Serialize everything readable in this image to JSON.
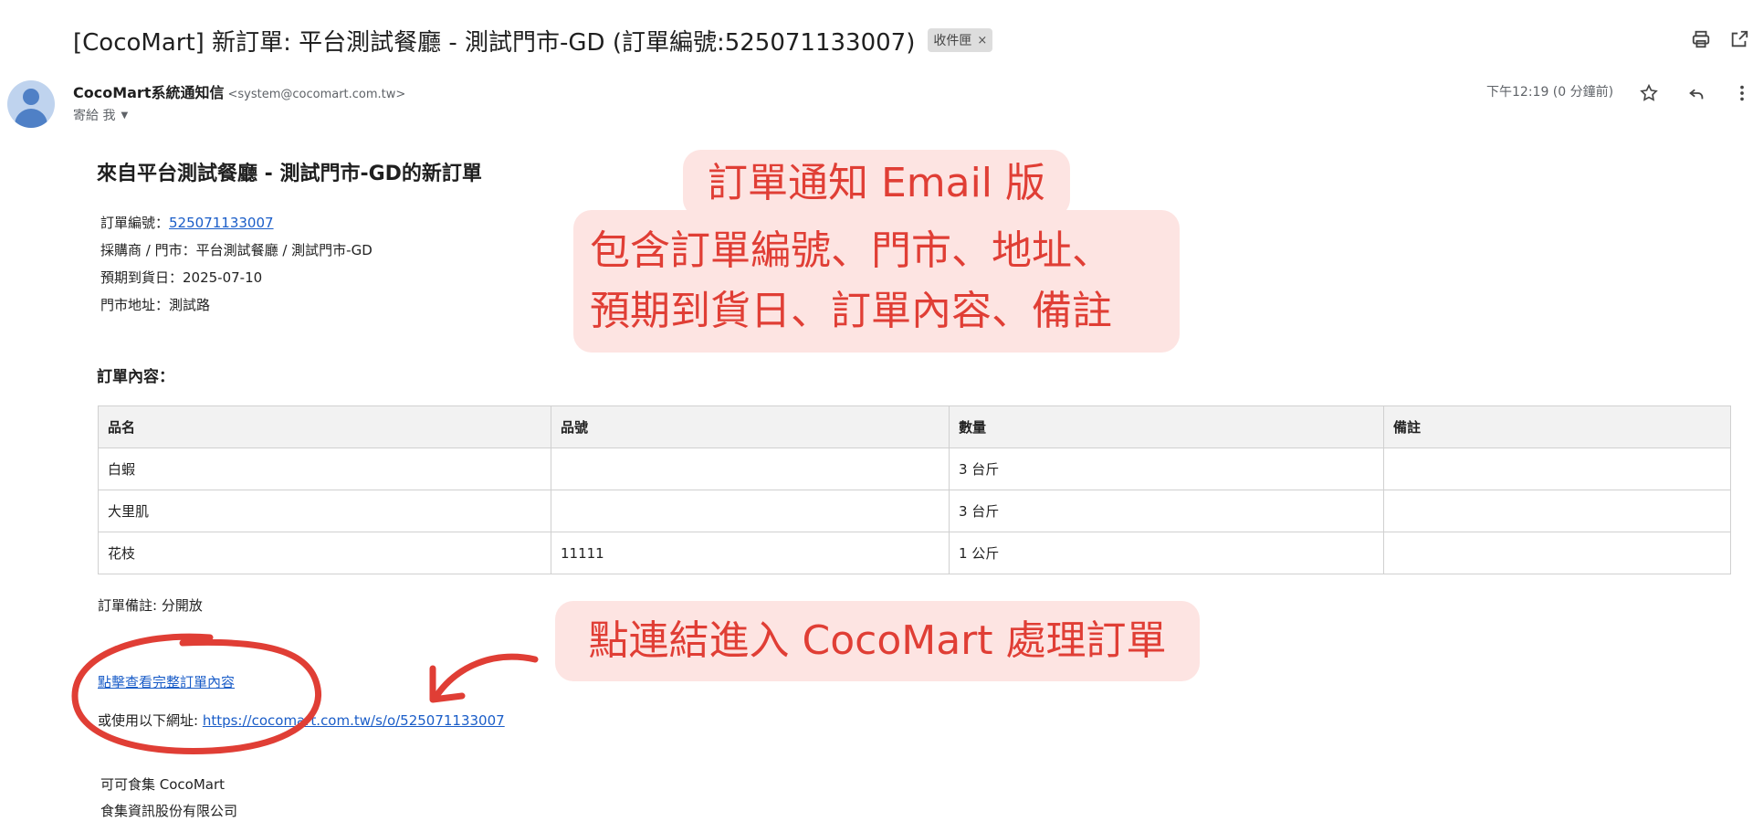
{
  "subject": {
    "text": "[CocoMart] 新訂單: 平台測試餐廳 - 測試門市-GD (訂單編號:525071133007)",
    "label": "收件匣",
    "label_remove": "×"
  },
  "toolbar": {
    "print_icon": "print-icon",
    "open_new_window_icon": "open-in-new-icon"
  },
  "sender": {
    "name": "CocoMart系統通知信",
    "email": "<system@cocomart.com.tw>",
    "to": "寄給 我",
    "time": "下午12:19 (0 分鐘前)"
  },
  "email": {
    "title": "來自平台測試餐廳 - 測試門市-GD的新訂單",
    "order_no_label": "訂單編號：",
    "order_no": "525071133007",
    "buyer_store": "採購商 / 門市：平台測試餐廳 / 測試門市-GD",
    "expected_date": "預期到貨日：2025-07-10",
    "store_address": "門市地址：測試路",
    "items_title": "訂單內容：",
    "columns": [
      "品名",
      "品號",
      "數量",
      "備註"
    ],
    "rows": [
      [
        "白蝦",
        "",
        "3 台斤",
        ""
      ],
      [
        "大里肌",
        "",
        "3 台斤",
        ""
      ],
      [
        "花枝",
        "11111",
        "1 公斤",
        ""
      ]
    ],
    "order_note": "訂單備註: 分開放",
    "view_link": "點擊查看完整訂單內容",
    "alt_prefix": "或使用以下網址: ",
    "alt_url": "https://cocomart.com.tw/s/o/525071133007",
    "footer_line1": "可可食集 CocoMart",
    "footer_line2": "食集資訊股份有限公司"
  },
  "annotations": {
    "callout_title": "訂單通知 Email 版",
    "callout_line1": "包含訂單編號、門市、地址、",
    "callout_line2": "預期到貨日、訂單內容、備註",
    "callout_link": "點連結進入 CocoMart 處理訂單",
    "color": "#e03e35",
    "background": "#fde4e2"
  }
}
